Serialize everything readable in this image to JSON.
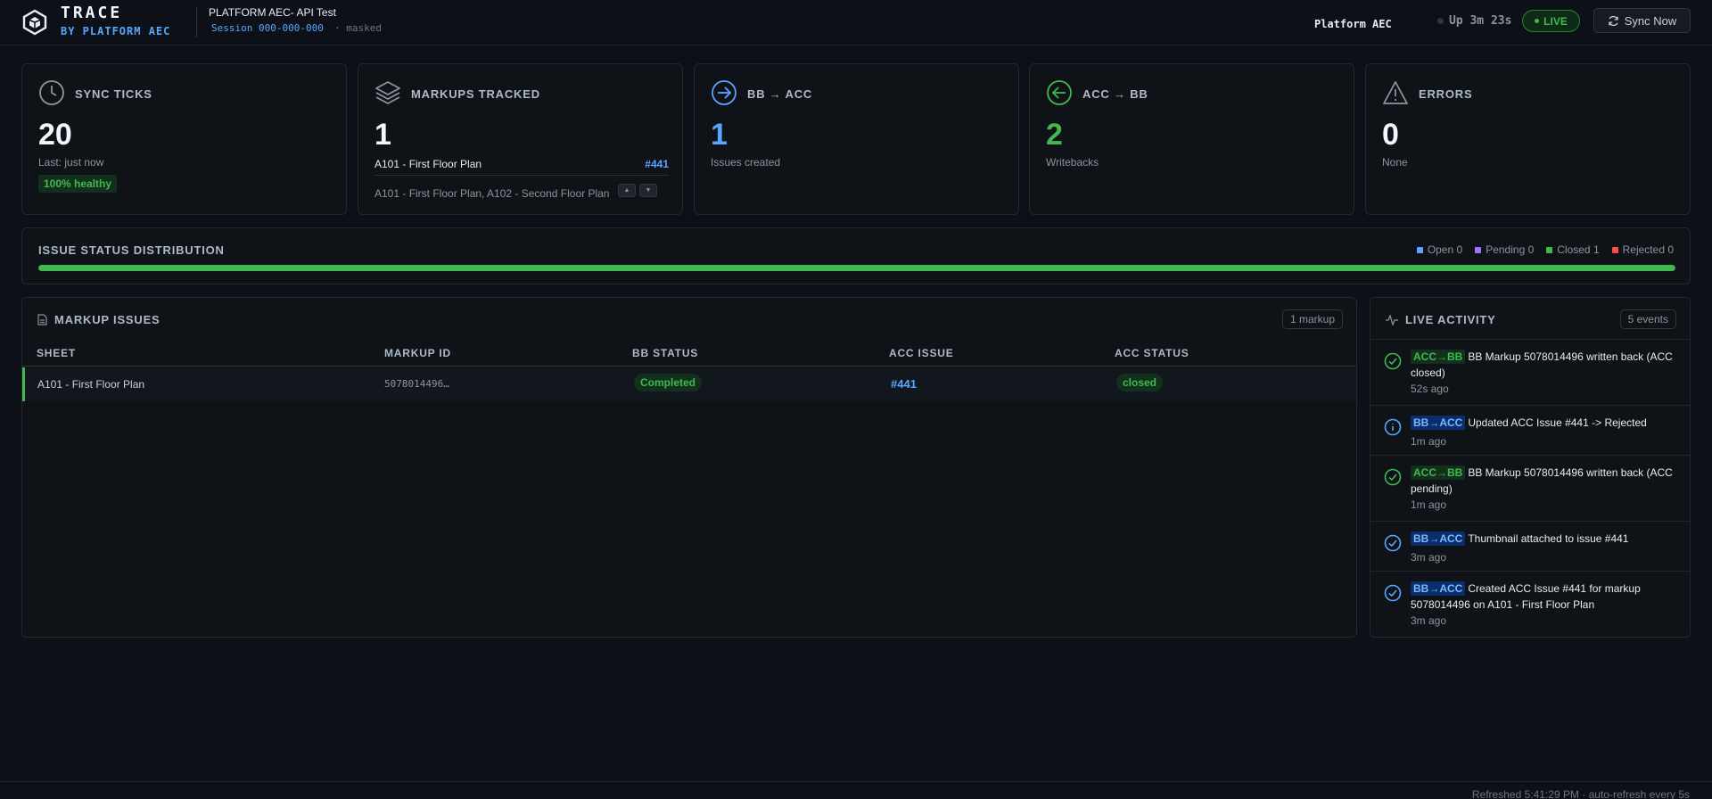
{
  "header": {
    "brand_title": "TRACE",
    "brand_subtitle": "BY PLATFORM AEC",
    "project": "PLATFORM AEC- API Test",
    "session": "Session 000-000-000",
    "session_mask": "· masked",
    "org": "Platform AEC",
    "uptime": "Up 3m 23s",
    "live_label": "LIVE",
    "sync_label": "Sync Now"
  },
  "stats": {
    "sync": {
      "label": "SYNC TICKS",
      "value": "20",
      "sub": "Last: just now",
      "badge": "100% healthy"
    },
    "markups": {
      "label": "MARKUPS TRACKED",
      "value": "1",
      "item": "A101 - First Floor Plan",
      "item_link": "#441",
      "list": "A101 - First Floor Plan, A102 - Second Floor Plan"
    },
    "bb_acc": {
      "label": "BB → ACC",
      "value": "1",
      "sub": "Issues created"
    },
    "acc_bb": {
      "label": "ACC → BB",
      "value": "2",
      "sub": "Writebacks"
    },
    "errors": {
      "label": "ERRORS",
      "value": "0",
      "sub": "None"
    }
  },
  "distribution": {
    "title": "ISSUE STATUS DISTRIBUTION",
    "legend": [
      {
        "label": "Open 0",
        "color": "#58a6ff"
      },
      {
        "label": "Pending 0",
        "color": "#a371f7"
      },
      {
        "label": "Closed 1",
        "color": "#3fb950"
      },
      {
        "label": "Rejected 0",
        "color": "#f85149"
      }
    ],
    "closed_fraction": 1.0
  },
  "issues": {
    "title": "MARKUP ISSUES",
    "count": "1 markup",
    "columns": [
      "SHEET",
      "MARKUP ID",
      "BB STATUS",
      "ACC ISSUE",
      "ACC STATUS"
    ],
    "rows": [
      {
        "sheet": "A101 - First Floor Plan",
        "markup_id": "5078014496…",
        "bb_status": "Completed",
        "acc_issue": "#441",
        "acc_status": "closed"
      }
    ]
  },
  "activity": {
    "title": "LIVE ACTIVITY",
    "count": "5 events",
    "events": [
      {
        "tag": "ACC→BB",
        "text": "BB Markup 5078014496 written back (ACC closed)",
        "time": "52s ago"
      },
      {
        "tag": "BB→ACC",
        "text": "Updated ACC Issue #441 -> Rejected",
        "time": "1m ago"
      },
      {
        "tag": "ACC→BB",
        "text": "BB Markup 5078014496 written back (ACC pending)",
        "time": "1m ago"
      },
      {
        "tag": "BB→ACC",
        "text": "Thumbnail attached to issue #441",
        "time": "3m ago"
      },
      {
        "tag": "BB→ACC",
        "text": "Created ACC Issue #441 for markup 5078014496 on A101 - First Floor Plan",
        "time": "3m ago"
      }
    ]
  },
  "footer": {
    "refreshed": "Refreshed 5:41:29 PM · auto-refresh every 5s"
  }
}
